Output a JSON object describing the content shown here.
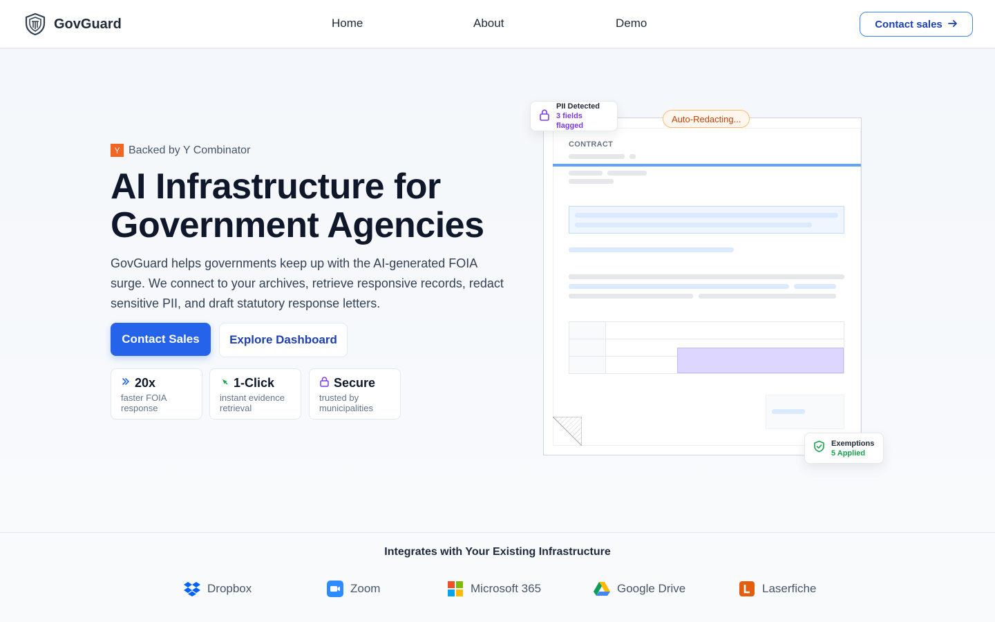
{
  "header": {
    "brand": "GovGuard",
    "nav": [
      "Home",
      "About",
      "Demo"
    ],
    "cta": "Contact sales"
  },
  "hero": {
    "badge_letter": "Y",
    "badge_text": "Backed by Y Combinator",
    "title_line1": "AI Infrastructure for",
    "title_line2": "Government Agencies",
    "description": "GovGuard helps governments keep up with the AI-generated FOIA surge. We connect to your archives, retrieve responsive records, redact sensitive PII, and draft statutory response letters.",
    "primary_button": "Contact Sales",
    "secondary_button": "Explore Dashboard",
    "stats": [
      {
        "value": "20x",
        "sub1": "faster FOIA",
        "sub2": "response"
      },
      {
        "value": "1-Click",
        "sub1": "instant evidence",
        "sub2": "retrieval"
      },
      {
        "value": "Secure",
        "sub1": "trusted by",
        "sub2": "municipalities"
      }
    ]
  },
  "document": {
    "label": "CONTRACT",
    "status_pill": "Auto-Redacting...",
    "pii_card": {
      "title": "PII Detected",
      "sub": "3 fields flagged"
    },
    "exemptions_card": {
      "title": "Exemptions",
      "sub": "5 Applied"
    }
  },
  "integrations": {
    "title": "Integrates with Your Existing Infrastructure",
    "items": [
      "Dropbox",
      "Zoom",
      "Microsoft 365",
      "Google Drive",
      "Laserfiche"
    ]
  },
  "colors": {
    "primary": "#2563eb",
    "accent_purple": "#7c3aed",
    "accent_green": "#16a34a",
    "accent_orange": "#c2410c"
  }
}
